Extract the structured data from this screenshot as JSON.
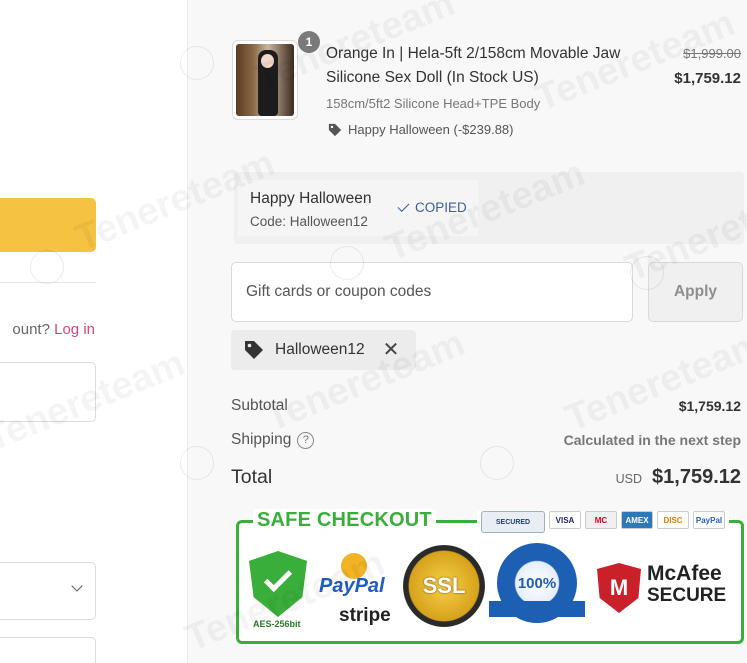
{
  "left_panel": {
    "account_prompt_partial": "ount?",
    "login_link": "Log in"
  },
  "order_item": {
    "quantity_badge": "1",
    "title": "Orange In | Hela-5ft 2/158cm Movable Jaw Silicone Sex Doll (In Stock US)",
    "variant": "158cm/5ft2 Silicone Head+TPE Body",
    "discount_line": "Happy Halloween (-$239.88)",
    "price_original": "$1,999.00",
    "price_current": "$1,759.12"
  },
  "promo": {
    "name": "Happy Halloween",
    "code_line": "Code: Halloween12",
    "copied_label": "COPIED"
  },
  "coupon": {
    "placeholder": "Gift cards or coupon codes",
    "apply_label": "Apply",
    "applied_code": "Halloween12",
    "remove_glyph": "✕"
  },
  "summary": {
    "subtotal_label": "Subtotal",
    "subtotal_value": "$1,759.12",
    "shipping_label": "Shipping",
    "shipping_help_glyph": "?",
    "shipping_value": "Calculated in the next step",
    "total_label": "Total",
    "total_currency": "USD",
    "total_value": "$1,759.12"
  },
  "safe_checkout": {
    "title": "SAFE CHECKOUT",
    "ssl_secured_badge": "SECURED",
    "cards": [
      "VISA",
      "MC",
      "AMEX",
      "DISC",
      "PayPal"
    ],
    "aes_label": "AES-256bit",
    "paypal_label": "PayPal",
    "stripe_label": "stripe",
    "ssl_label": "SSL",
    "guarantee_label": "100%",
    "mcafee_label": "McAfee",
    "mcafee_secure": "SECURE"
  },
  "watermark": "Tenereteam",
  "colors": {
    "accent_yellow": "#f5c242",
    "link_pink": "#d6457b",
    "copied_blue": "#3a5f9e",
    "safe_green": "#3aae3a",
    "panel_bg": "#f8f8f8"
  }
}
